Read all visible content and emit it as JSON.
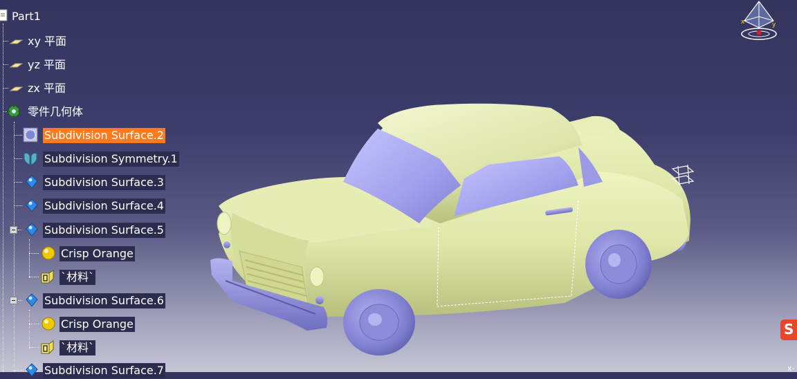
{
  "tree": {
    "root": "Part1",
    "items": [
      {
        "label": "xy 平面",
        "icon": "plane-icon",
        "state": "normal"
      },
      {
        "label": "yz 平面",
        "icon": "plane-icon",
        "state": "normal"
      },
      {
        "label": "zx 平面",
        "icon": "plane-icon",
        "state": "normal"
      },
      {
        "label": "零件几何体",
        "icon": "part-body-gear-icon",
        "state": "normal"
      },
      {
        "label": "Subdivision Surface.2",
        "icon": "subdivision-surface-icon",
        "state": "selected"
      },
      {
        "label": "Subdivision Symmetry.1",
        "icon": "subdivision-symmetry-icon",
        "state": "boxed"
      },
      {
        "label": "Subdivision Surface.3",
        "icon": "blue-gem-icon",
        "state": "boxed"
      },
      {
        "label": "Subdivision Surface.4",
        "icon": "blue-gem-icon",
        "state": "boxed"
      },
      {
        "label": "Subdivision Surface.5",
        "icon": "blue-gem-icon",
        "state": "boxed"
      },
      {
        "label": "Crisp Orange",
        "icon": "yellow-sphere-icon",
        "state": "boxed"
      },
      {
        "label": "`材料`",
        "icon": "material-box-icon",
        "state": "boxed"
      },
      {
        "label": "Subdivision Surface.6",
        "icon": "blue-gem-icon",
        "state": "boxed"
      },
      {
        "label": "Crisp Orange",
        "icon": "yellow-sphere-icon",
        "state": "boxed"
      },
      {
        "label": "`材料`",
        "icon": "material-box-icon",
        "state": "boxed"
      },
      {
        "label": "Subdivision Surface.7",
        "icon": "blue-gem-icon",
        "state": "boxed"
      }
    ]
  },
  "compass": {
    "x_label": "x",
    "y_label": "y"
  },
  "colors": {
    "background_top": "#34345e",
    "background_bottom": "#c6c6d6",
    "car_body": "#dfe6a8",
    "car_glass": "#a9a9ee",
    "car_chrome": "#8e8ed6",
    "selection": "#ff7a1a"
  },
  "logo": {
    "text": "S"
  },
  "corner_text": "x-"
}
